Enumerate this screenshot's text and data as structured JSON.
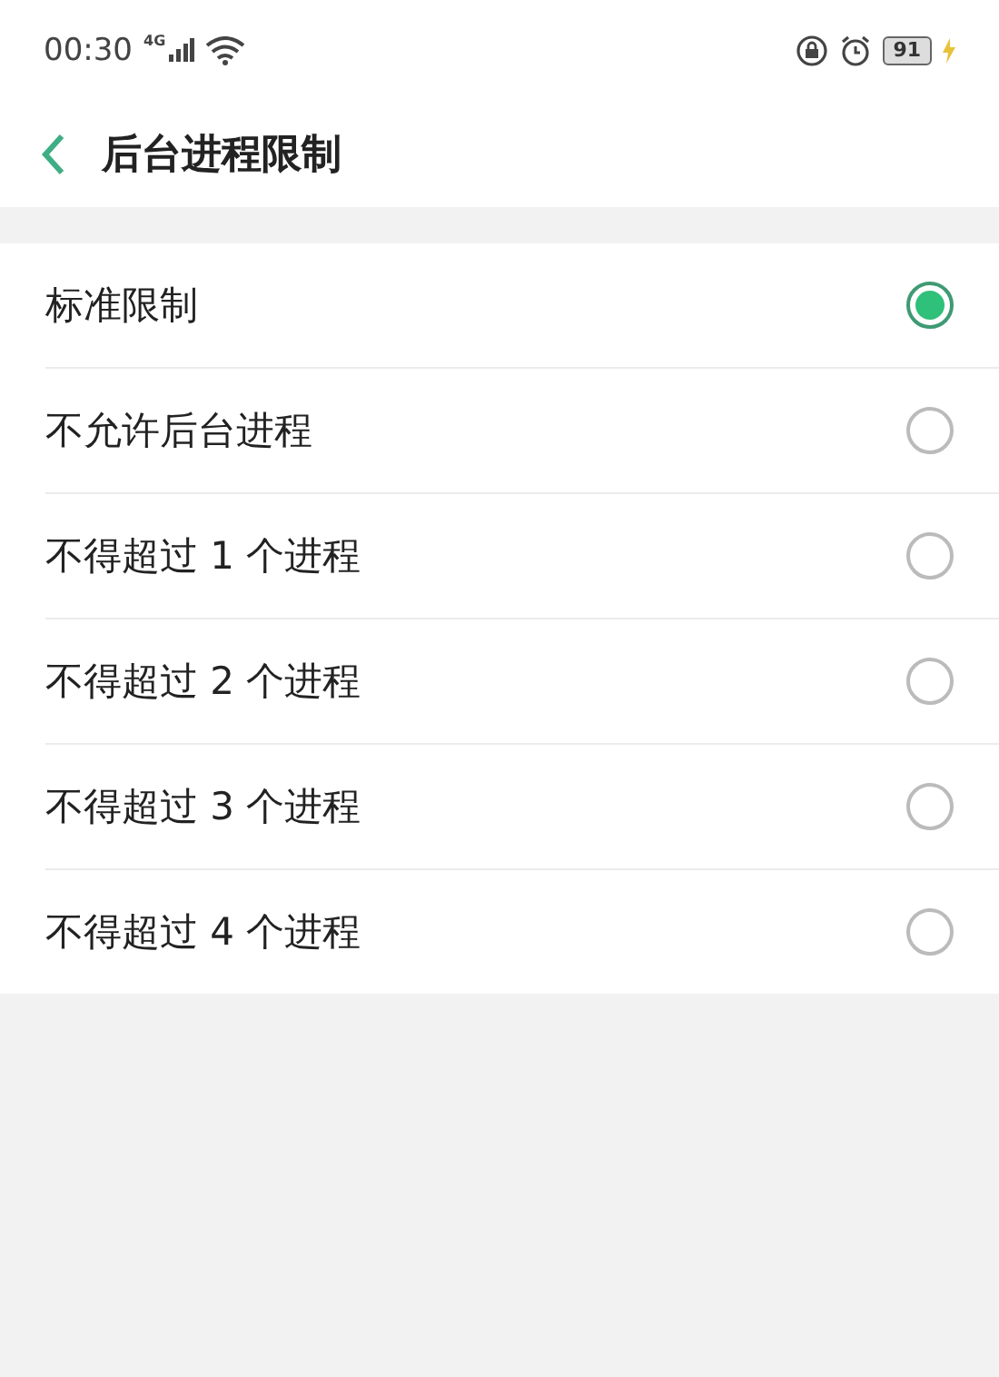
{
  "status_bar": {
    "time": "00:30",
    "network": "4G",
    "battery": "91"
  },
  "header": {
    "title": "后台进程限制"
  },
  "options": [
    {
      "label": "标准限制",
      "selected": true
    },
    {
      "label": "不允许后台进程",
      "selected": false
    },
    {
      "label": "不得超过 1 个进程",
      "selected": false
    },
    {
      "label": "不得超过 2 个进程",
      "selected": false
    },
    {
      "label": "不得超过 3 个进程",
      "selected": false
    },
    {
      "label": "不得超过 4 个进程",
      "selected": false
    }
  ]
}
